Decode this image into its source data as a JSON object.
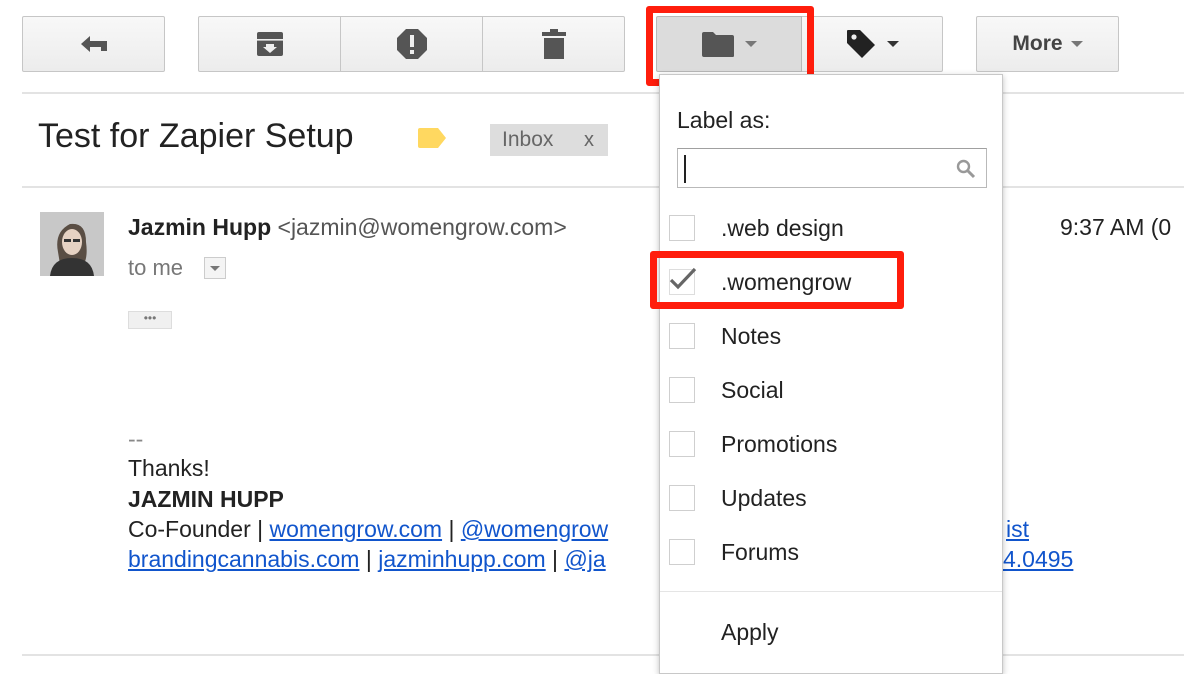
{
  "toolbar": {
    "back_icon": "reply-arrow-icon",
    "archive_icon": "archive-icon",
    "spam_icon": "report-spam-icon",
    "delete_icon": "trash-icon",
    "move_icon": "folder-icon",
    "labels_icon": "label-tag-icon",
    "more_label": "More"
  },
  "subject": {
    "title": "Test for Zapier Setup",
    "inbox_chip": "Inbox",
    "chip_close": "x",
    "tag_color": "#ffd860"
  },
  "message": {
    "sender_name": "Jazmin Hupp",
    "sender_email": "<jazmin@womengrow.com>",
    "to_line": "to me",
    "time": "9:37 AM (0",
    "signature": {
      "dashes": "--",
      "thanks": "Thanks!",
      "name": "JAZMIN HUPP",
      "line1_prefix": "Co-Founder | ",
      "line1_link1": "womengrow.com",
      "line1_sep": " | ",
      "line1_link2": "@womengrow",
      "line1_tail": "ist",
      "line2_link1": "brandingcannabis.com",
      "line2_sep1": " | ",
      "line2_link2": "jazminhupp.com",
      "line2_sep2": " | ",
      "line2_link3": "@ja",
      "line2_tail": "4.0495"
    }
  },
  "label_menu": {
    "title": "Label as:",
    "search_value": "",
    "items": [
      {
        "label": ".web design",
        "checked": false
      },
      {
        "label": ".womengrow",
        "checked": true
      },
      {
        "label": "Notes",
        "checked": false
      },
      {
        "label": "Social",
        "checked": false
      },
      {
        "label": "Promotions",
        "checked": false
      },
      {
        "label": "Updates",
        "checked": false
      },
      {
        "label": "Forums",
        "checked": false
      }
    ],
    "apply_label": "Apply"
  },
  "colors": {
    "highlight_red": "#ff1d0c",
    "link_blue": "#1155cc"
  }
}
